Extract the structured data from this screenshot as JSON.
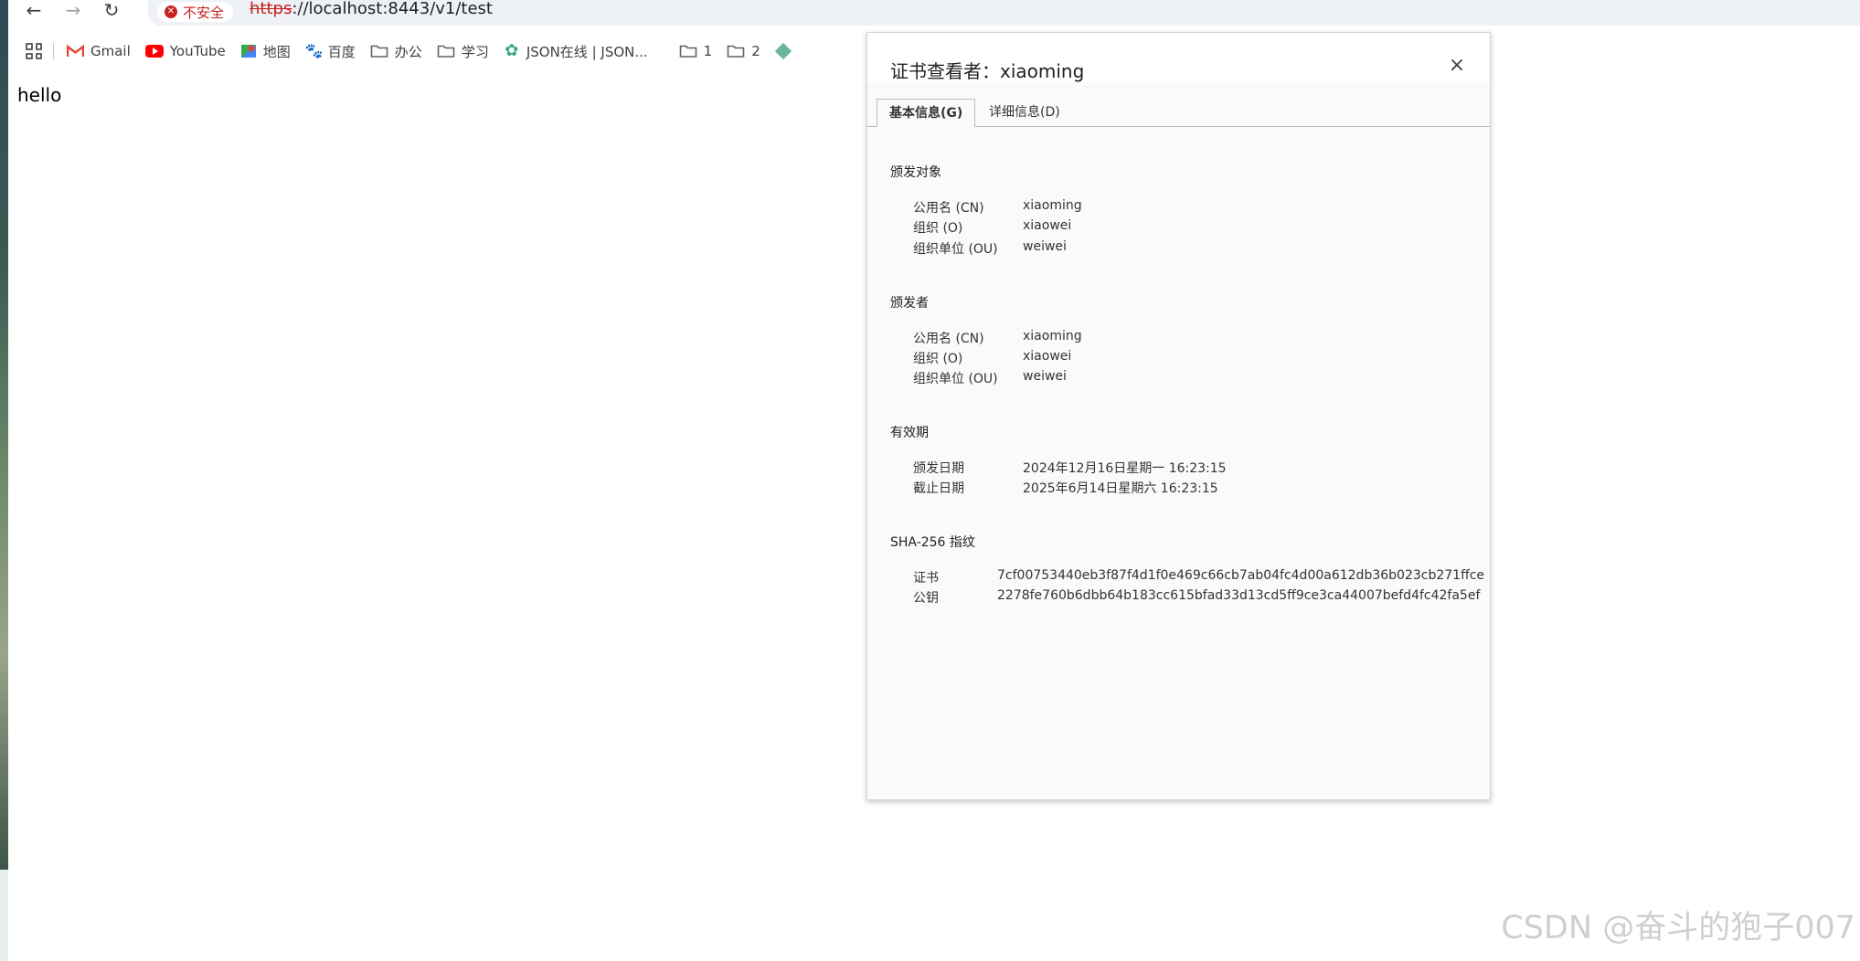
{
  "browser": {
    "security_label": "不安全",
    "url_scheme": "https",
    "url_rest": "://localhost:8443/v1/test"
  },
  "bookmarks": [
    {
      "label": "Gmail",
      "icon": "gmail-icon"
    },
    {
      "label": "YouTube",
      "icon": "youtube-icon"
    },
    {
      "label": "地图",
      "icon": "maps-icon"
    },
    {
      "label": "百度",
      "icon": "baidu-icon"
    },
    {
      "label": "办公",
      "icon": "folder-icon"
    },
    {
      "label": "学习",
      "icon": "folder-icon"
    },
    {
      "label": "JSON在线 | JSON...",
      "icon": "json-icon"
    },
    {
      "label": "1",
      "icon": "folder-icon"
    },
    {
      "label": "2",
      "icon": "folder-icon"
    }
  ],
  "page": {
    "body_text": "hello"
  },
  "dialog": {
    "title": "证书查看者：xiaoming",
    "close_glyph": "×",
    "tabs": [
      {
        "label": "基本信息(G)",
        "active": true
      },
      {
        "label": "详细信息(D)",
        "active": false
      }
    ],
    "subject": {
      "heading": "颁发对象",
      "rows": [
        {
          "label": "公用名 (CN)",
          "value": "xiaoming"
        },
        {
          "label": "组织 (O)",
          "value": "xiaowei"
        },
        {
          "label": "组织单位 (OU)",
          "value": "weiwei"
        }
      ]
    },
    "issuer": {
      "heading": "颁发者",
      "rows": [
        {
          "label": "公用名 (CN)",
          "value": "xiaoming"
        },
        {
          "label": "组织 (O)",
          "value": "xiaowei"
        },
        {
          "label": "组织单位 (OU)",
          "value": "weiwei"
        }
      ]
    },
    "validity": {
      "heading": "有效期",
      "rows": [
        {
          "label": "颁发日期",
          "value": "2024年12月16日星期一 16:23:15"
        },
        {
          "label": "截止日期",
          "value": "2025年6月14日星期六 16:23:15"
        }
      ]
    },
    "fingerprints": {
      "heading": "SHA-256 指纹",
      "rows": [
        {
          "label": "证书",
          "value": "7cf00753440eb3f87f4d1f0e469c66cb7ab04fc4d00a612db36b023cb271ffce"
        },
        {
          "label": "公钥",
          "value": "2278fe760b6dbb64b183cc615bfad33d13cd5ff9ce3ca44007befd4fc42fa5ef"
        }
      ]
    }
  },
  "watermark": "CSDN @奋斗的狍子007",
  "colors": {
    "insecure_red": "#c5221f",
    "accent": "#1a73e8"
  }
}
